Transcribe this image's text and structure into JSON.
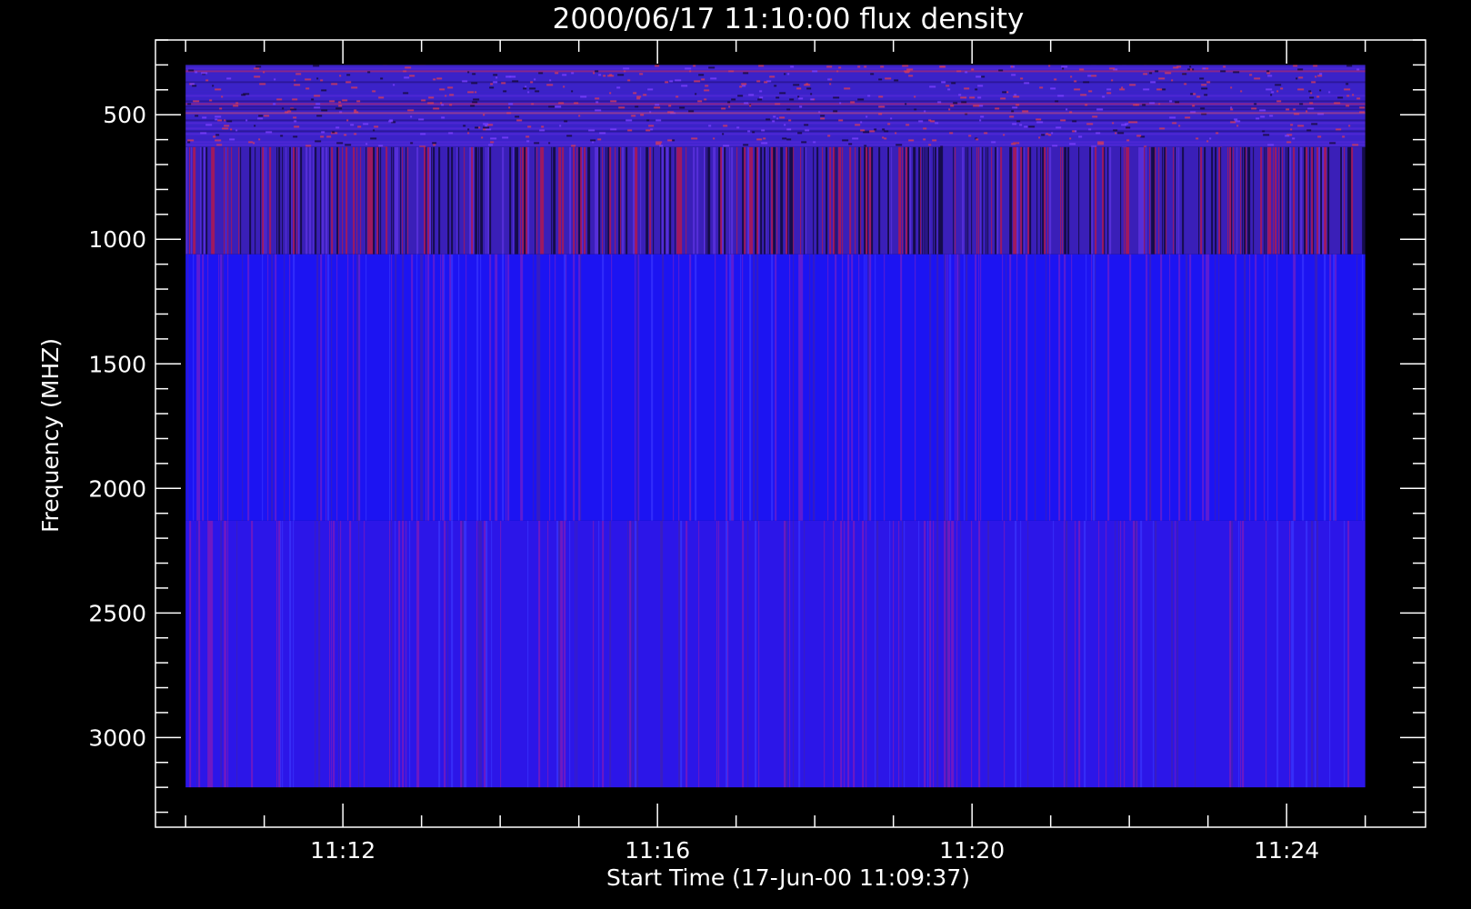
{
  "chart_data": {
    "type": "heatmap",
    "title": "2000/06/17 11:10:00 flux density",
    "xlabel": "Start Time (17-Jun-00 11:09:37)",
    "ylabel": "Frequency (MHZ)",
    "xlim": [
      "11:09:37",
      "11:25:46"
    ],
    "ylim": [
      200,
      3360
    ],
    "y_axis_inverted": true,
    "data_extent": {
      "time_start": "11:10:00",
      "time_end": "11:25:00",
      "freq_min": 300,
      "freq_max": 3200
    },
    "x_ticks": [
      "11:12",
      "11:16",
      "11:20",
      "11:24"
    ],
    "x_tick_minutes": [
      12,
      16,
      20,
      24
    ],
    "x_minor_tick_minutes": [
      10,
      11,
      12,
      13,
      14,
      15,
      16,
      17,
      18,
      19,
      20,
      21,
      22,
      23,
      24,
      25
    ],
    "y_ticks": [
      500,
      1000,
      1500,
      2000,
      2500,
      3000
    ],
    "y_minor_step": 100,
    "bands": [
      {
        "freq_start": 300,
        "freq_end": 630,
        "style": "speckled",
        "base_color": "#3b22cc",
        "streak_color": "#c62a55"
      },
      {
        "freq_start": 630,
        "freq_end": 1060,
        "style": "striped-dark",
        "base_color": "#3a1fb8",
        "streak_color": "#b01850"
      },
      {
        "freq_start": 1060,
        "freq_end": 2130,
        "style": "striped-bright",
        "base_color": "#1c14f2",
        "streak_color": "#7a1fc8"
      },
      {
        "freq_start": 2130,
        "freq_end": 3200,
        "style": "striped",
        "base_color": "#2c16e8",
        "streak_color": "#8a1ab4"
      }
    ],
    "colors": {
      "background": "#000000",
      "axes": "#ffffff",
      "text": "#ffffff"
    },
    "grid": false,
    "legend": "none"
  }
}
